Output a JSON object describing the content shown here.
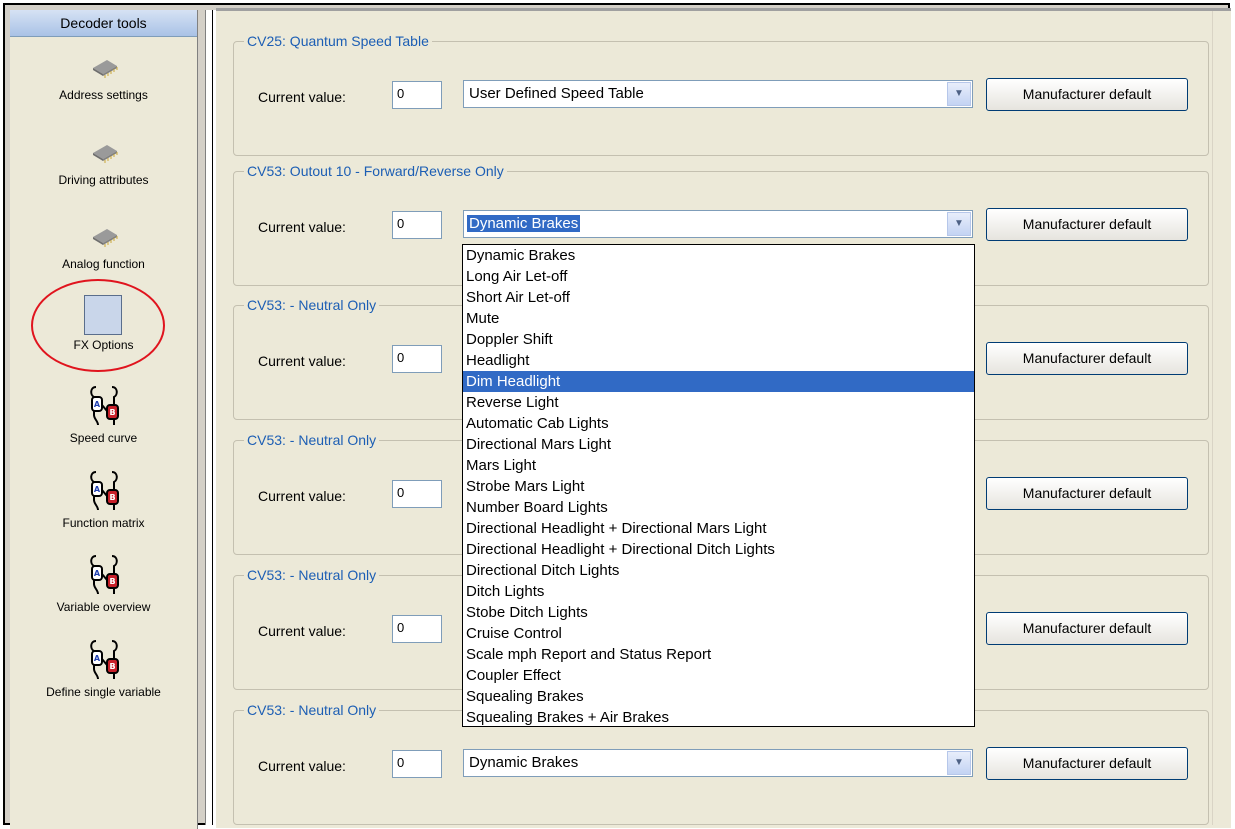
{
  "sidebar": {
    "title": "Decoder tools",
    "items": [
      {
        "label": "Address settings",
        "icon": "chip-icon"
      },
      {
        "label": "Driving attributes",
        "icon": "chip-icon"
      },
      {
        "label": "Analog function",
        "icon": "chip-icon"
      },
      {
        "label": "FX Options",
        "icon": "chip-icon",
        "selected": true
      },
      {
        "label": "Speed curve",
        "icon": "ab-component-icon"
      },
      {
        "label": "Function matrix",
        "icon": "ab-component-icon"
      },
      {
        "label": "Variable overview",
        "icon": "ab-component-icon"
      },
      {
        "label": "Define single variable",
        "icon": "ab-component-icon"
      }
    ]
  },
  "common": {
    "current_value_label": "Current value:",
    "manufacturer_default_label": "Manufacturer default"
  },
  "groups": [
    {
      "title": "CV25: Quantum Speed Table",
      "value": "0",
      "selected": "User Defined Speed Table"
    },
    {
      "title": "CV53: Outout 10 - Forward/Reverse Only",
      "value": "0",
      "selected": "Dynamic Brakes",
      "open": true
    },
    {
      "title": "CV53: - Neutral Only",
      "value": "0",
      "selected": ""
    },
    {
      "title": "CV53: - Neutral Only",
      "value": "0",
      "selected": ""
    },
    {
      "title": "CV53: - Neutral Only",
      "value": "0",
      "selected": ""
    },
    {
      "title": "CV53: - Neutral Only",
      "value": "0",
      "selected": "Dynamic Brakes"
    }
  ],
  "dropdown": {
    "highlighted": "Dim Headlight",
    "options": [
      "Dynamic Brakes",
      "Long Air Let-off",
      "Short Air Let-off",
      "Mute",
      "Doppler Shift",
      "Headlight",
      "Dim Headlight",
      "Reverse Light",
      "Automatic Cab Lights",
      "Directional Mars Light",
      "Mars Light",
      "Strobe Mars Light",
      "Number Board Lights",
      "Directional Headlight + Directional Mars Light",
      "Directional Headlight + Directional Ditch Lights",
      "Directional Ditch Lights",
      "Ditch Lights",
      "Stobe Ditch Lights",
      "Cruise Control",
      "Scale mph Report and Status Report",
      "Coupler Effect",
      "Squealing Brakes",
      "Squealing Brakes + Air Brakes"
    ]
  },
  "colors": {
    "accent": "#316ac5",
    "group_title": "#1c5eb4",
    "selection_ring": "#e0141e"
  }
}
